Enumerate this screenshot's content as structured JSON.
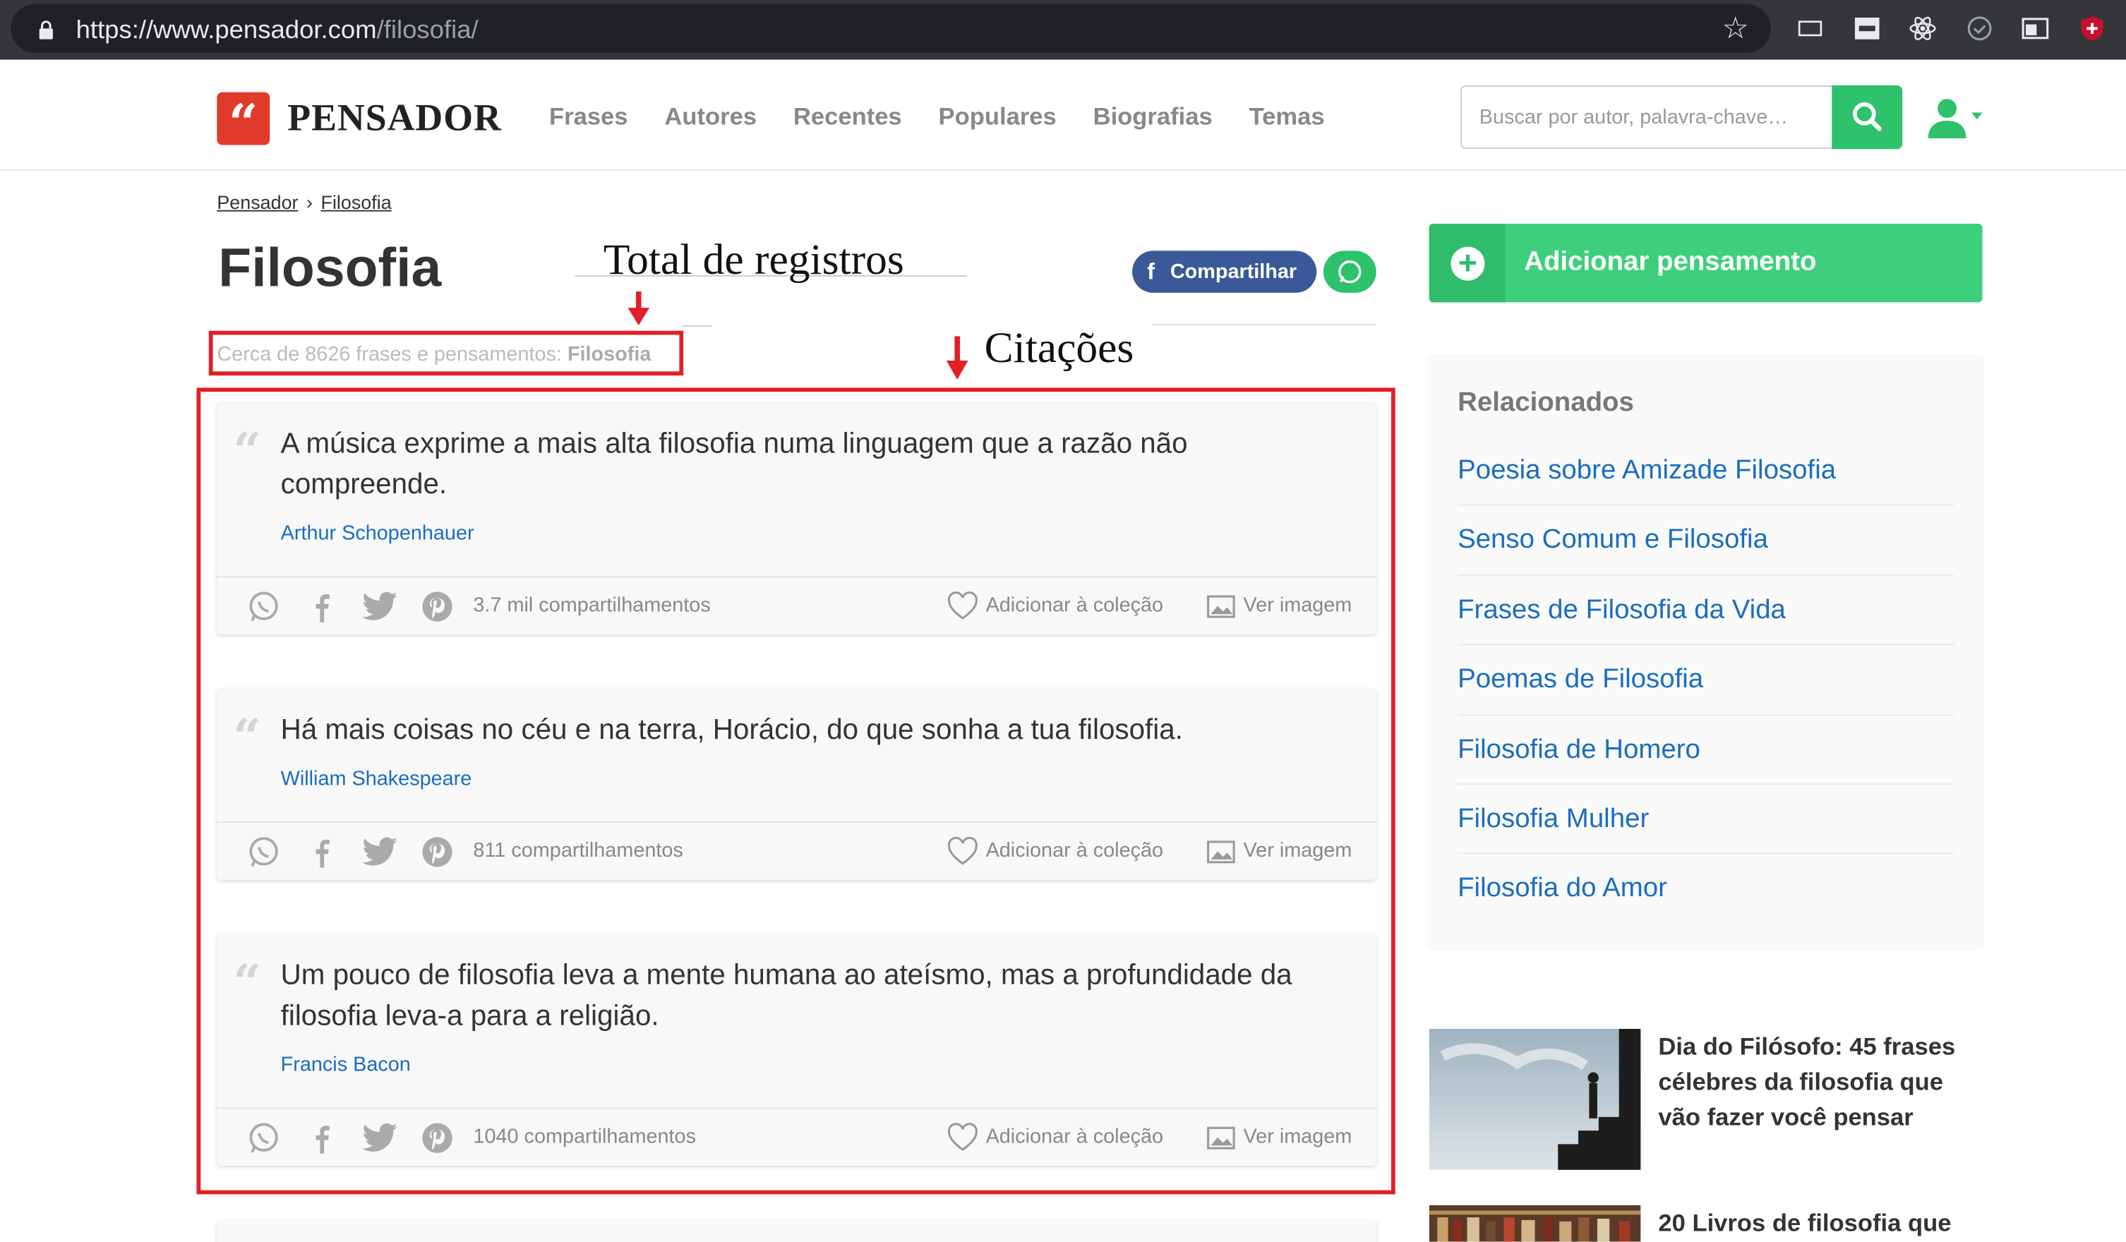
{
  "browser": {
    "url_host": "https://www.pensador.com",
    "url_path": "/filosofia/"
  },
  "site": {
    "logo_mark": "“",
    "logo_text": "PENSADOR",
    "nav": [
      "Frases",
      "Autores",
      "Recentes",
      "Populares",
      "Biografias",
      "Temas"
    ],
    "search_placeholder": "Buscar por autor, palavra-chave…"
  },
  "breadcrumb": [
    "Pensador",
    "Filosofia"
  ],
  "page": {
    "title": "Filosofia",
    "count_prefix": "Cerca de 8626 frases e pensamentos:",
    "count_topic": "Filosofia",
    "share_facebook": "Compartilhar"
  },
  "annotations": {
    "total": "Total de registros",
    "quotes": "Citações"
  },
  "quotes": [
    {
      "text": "A música exprime a mais alta filosofia numa linguagem que a razão não compreende.",
      "author": "Arthur Schopenhauer",
      "shares": "3.7 mil compartilhamentos"
    },
    {
      "text": "Há mais coisas no céu e na terra, Horácio, do que sonha a tua filosofia.",
      "author": "William Shakespeare",
      "shares": "811 compartilhamentos"
    },
    {
      "text": "Um pouco de filosofia leva a mente humana ao ateísmo, mas a profundidade da filosofia leva-a para a religião.",
      "author": "Francis Bacon",
      "shares": "1040 compartilhamentos"
    }
  ],
  "card_actions": {
    "add_collection": "Adicionar à coleção",
    "see_image": "Ver imagem"
  },
  "sidebar": {
    "add_button": "Adicionar pensamento",
    "related_title": "Relacionados",
    "related": [
      "Poesia sobre Amizade Filosofia",
      "Senso Comum e Filosofia",
      "Frases de Filosofia da Vida",
      "Poemas de Filosofia",
      "Filosofia de Homero",
      "Filosofia Mulher",
      "Filosofia do Amor"
    ],
    "articles": [
      "Dia do Filósofo: 45 frases célebres da filosofia que vão fazer você pensar",
      "20 Livros de filosofia que"
    ]
  },
  "colors": {
    "accent_green": "#2dc26b",
    "link_blue": "#1a6dc0",
    "annotation_red": "#e21f26",
    "logo_red": "#e03b2a"
  }
}
